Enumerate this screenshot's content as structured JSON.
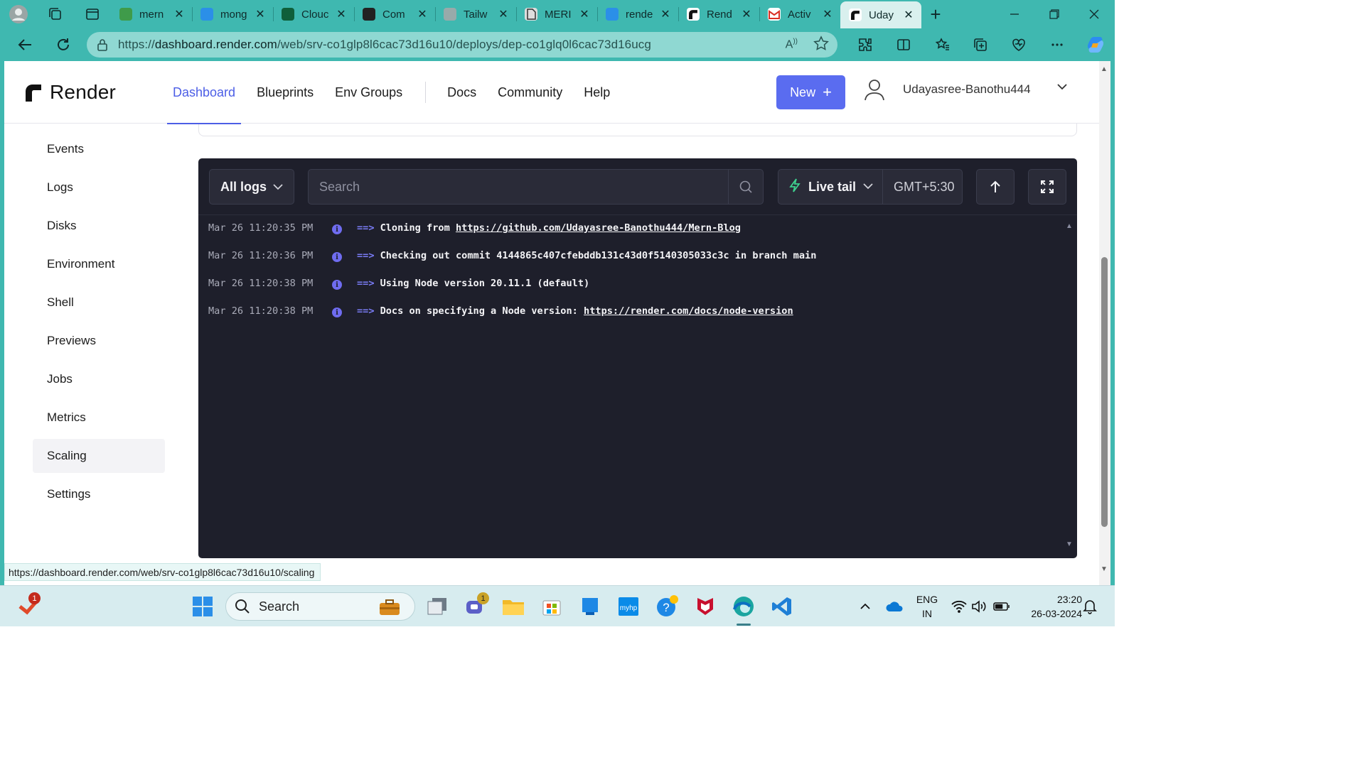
{
  "browser": {
    "tabs": [
      {
        "title": "mern",
        "icon": "mongodb-leaf-icon"
      },
      {
        "title": "mong",
        "icon": "search-icon"
      },
      {
        "title": "Clouc",
        "icon": "cloud-leaf-icon"
      },
      {
        "title": "Com",
        "icon": "github-icon"
      },
      {
        "title": "Tailw",
        "icon": "openai-icon"
      },
      {
        "title": "MERI",
        "icon": "document-icon"
      },
      {
        "title": "rende",
        "icon": "search-icon"
      },
      {
        "title": "Rend",
        "icon": "render-icon"
      },
      {
        "title": "Activ",
        "icon": "gmail-icon"
      },
      {
        "title": "Uday",
        "icon": "render-icon",
        "active": true
      }
    ],
    "url_prefix": "https://",
    "url_domain": "dashboard.render.com",
    "url_path": "/web/srv-co1glp8l6cac73d16u10/deploys/dep-co1glq0l6cac73d16ucg",
    "status_url": "https://dashboard.render.com/web/srv-co1glp8l6cac73d16u10/scaling"
  },
  "header": {
    "brand": "Render",
    "nav": [
      {
        "label": "Dashboard",
        "active": true
      },
      {
        "label": "Blueprints"
      },
      {
        "label": "Env Groups"
      }
    ],
    "nav_secondary": [
      {
        "label": "Docs"
      },
      {
        "label": "Community"
      },
      {
        "label": "Help"
      }
    ],
    "new_button": "New",
    "username": "Udayasree-Banothu444"
  },
  "sidebar": {
    "items": [
      {
        "label": "Events"
      },
      {
        "label": "Logs"
      },
      {
        "label": "Disks"
      },
      {
        "label": "Environment"
      },
      {
        "label": "Shell"
      },
      {
        "label": "Previews"
      },
      {
        "label": "Jobs"
      },
      {
        "label": "Metrics"
      },
      {
        "label": "Scaling",
        "active": true
      },
      {
        "label": "Settings"
      }
    ]
  },
  "logs": {
    "filter": "All logs",
    "search_placeholder": "Search",
    "live_tail": "Live tail",
    "timezone": "GMT+5:30",
    "arrow": "==>",
    "lines": [
      {
        "time": "Mar 26 11:20:35 PM",
        "text": "Cloning from ",
        "link": "https://github.com/Udayasree-Banothu444/Mern-Blog"
      },
      {
        "time": "Mar 26 11:20:36 PM",
        "text": "Checking out commit 4144865c407cfebddb131c43d0f5140305033c3c in branch main",
        "link": ""
      },
      {
        "time": "Mar 26 11:20:38 PM",
        "text": "Using Node version 20.11.1 (default)",
        "link": ""
      },
      {
        "time": "Mar 26 11:20:38 PM",
        "text": "Docs on specifying a Node version: ",
        "link": "https://render.com/docs/node-version"
      }
    ]
  },
  "taskbar": {
    "search_label": "Search",
    "lang_top": "ENG",
    "lang_bottom": "IN",
    "time": "23:20",
    "date": "26-03-2024",
    "start_badge": "1",
    "teams_badge": "1"
  },
  "colors": {
    "accent": "#5a6cf0",
    "browser_frame": "#3fb8b0",
    "log_bg": "#1e1f2b"
  }
}
